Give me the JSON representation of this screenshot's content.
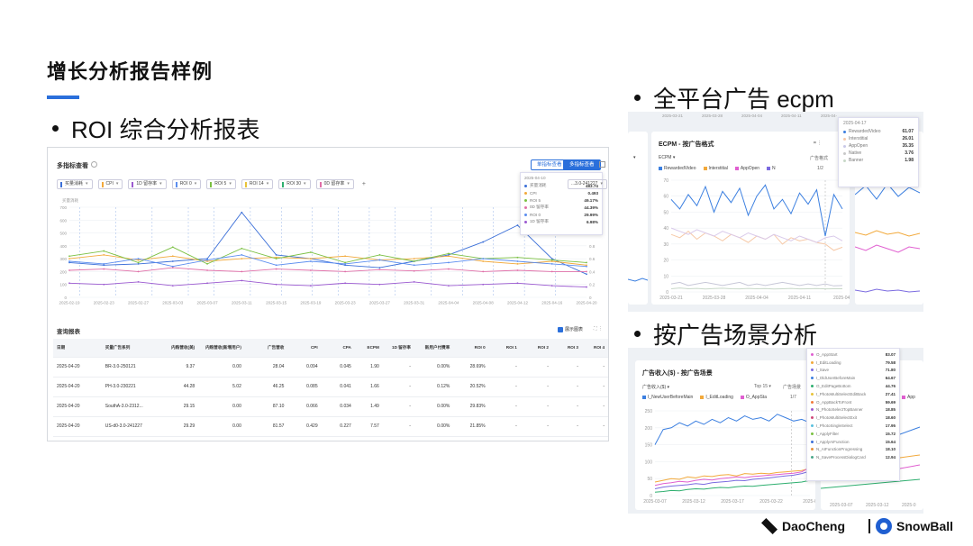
{
  "slide": {
    "title": "增长分析报告样例",
    "section_roi": "ROI 综合分析报表",
    "section_ecpm": "全平台广告 ecpm",
    "section_scene": "按广告场景分析"
  },
  "roi_panel": {
    "title": "多指标查看",
    "mode_single": "单指标查看",
    "mode_multi": "多指标查看",
    "metrics": [
      {
        "label": "买量消耗",
        "color": "#3b6fd8"
      },
      {
        "label": "CPI",
        "color": "#f2a93b"
      },
      {
        "label": "1D 留存率",
        "color": "#9b59d0"
      },
      {
        "label": "ROI 0",
        "color": "#5b8def"
      },
      {
        "label": "ROI 5",
        "color": "#7bc043"
      },
      {
        "label": "ROI 14",
        "color": "#e8c33a"
      },
      {
        "label": "ROI 30",
        "color": "#2eaf6f"
      },
      {
        "label": "0D 留存率",
        "color": "#e06fa8"
      }
    ],
    "add_label": "+",
    "left_axis_name": "买量消耗",
    "right_axis_name": "CPI",
    "tooltip": {
      "date": "2025-04-10",
      "rows": [
        {
          "name": "买量消耗",
          "value": "483.74",
          "color": "#3b6fd8"
        },
        {
          "name": "CPI",
          "value": "0.493",
          "color": "#f2a93b"
        },
        {
          "name": "ROI 5",
          "value": "49.17%",
          "color": "#7bc043"
        },
        {
          "name": "0D 留存率",
          "value": "44.39%",
          "color": "#e06fa8"
        },
        {
          "name": "ROI 0",
          "value": "29.99%",
          "color": "#5b8def"
        },
        {
          "name": "1D 留存率",
          "value": "6.98%",
          "color": "#9b59d0"
        }
      ]
    },
    "select_value": "...3.0-241227",
    "report_title": "查询报表",
    "report_toggle": "展示图表",
    "report_icons": "⛶  ⋮",
    "table": {
      "headers": [
        "日期",
        "买量广告系列",
        "内购营收(美)",
        "内购营收(新增用户)",
        "广告营收",
        "CPI",
        "CPA",
        "ECPM",
        "1D 留存率",
        "新用户付费率",
        "ROI 0",
        "ROI 1",
        "ROI 2",
        "ROI 3",
        "ROI 4"
      ],
      "rows": [
        [
          "2025-04-20",
          "BR-3.0-250121",
          "9.37",
          "0.00",
          "28.04",
          "0.094",
          "0.045",
          "1.90",
          "-",
          "0.00%",
          "28.69%",
          "-",
          "-",
          "-",
          "-"
        ],
        [
          "2025-04-20",
          "PH-3.0-230221",
          "44.28",
          "5.02",
          "46.25",
          "0.085",
          "0.041",
          "1.66",
          "-",
          "0.12%",
          "20.52%",
          "-",
          "-",
          "-",
          "-"
        ],
        [
          "2025-04-20",
          "SouthA-3.0-2312...",
          "29.15",
          "0.00",
          "87.10",
          "0.066",
          "0.034",
          "1.49",
          "-",
          "0.00%",
          "29.83%",
          "-",
          "-",
          "-",
          "-"
        ],
        [
          "2025-04-20",
          "US-d0-3.0-241227",
          "29.29",
          "0.00",
          "81.57",
          "0.429",
          "0.227",
          "7.57",
          "-",
          "0.00%",
          "21.85%",
          "-",
          "-",
          "-",
          "-"
        ],
        [
          "2025-04-19",
          "BR-3.0-250121",
          "19.96",
          "4.99",
          "48.18",
          "0.091",
          "0.036",
          "2.23",
          "1.01%",
          "0.12%",
          "44.27%",
          "44.38%",
          "-",
          "-",
          "-"
        ]
      ]
    }
  },
  "ecpm_panel": {
    "title": "ECPM - 按广告格式",
    "sub": "ECPM ▾",
    "format_ctrl": "广告格式",
    "page_ctrl": "1/2",
    "legend": [
      {
        "label": "RewardedVideo",
        "color": "#3b7fe0"
      },
      {
        "label": "Interstitial",
        "color": "#f2a93b"
      },
      {
        "label": "AppOpen",
        "color": "#e05fd0"
      },
      {
        "label": "N",
        "color": "#7b6be0"
      }
    ],
    "tooltip": {
      "date": "2025-04-17",
      "rows": [
        {
          "name": "RewardedVideo",
          "value": "61.07",
          "color": "#3b7fe0"
        },
        {
          "name": "Interstitial",
          "value": "26.01",
          "color": "#f6c9a8"
        },
        {
          "name": "AppOpen",
          "value": "35.35",
          "color": "#c9c9e8"
        },
        {
          "name": "Native",
          "value": "3.76",
          "color": "#c8c8c8"
        },
        {
          "name": "Banner",
          "value": "1.98",
          "color": "#c8d8c8"
        }
      ]
    },
    "top_ticks": [
      "2025-03-21",
      "2025-03-28",
      "2025-04-04",
      "2025-04-11",
      "2025-04-"
    ],
    "left_card_label": "▾"
  },
  "scene_panel": {
    "title": "广告收入($) - 按广告场景",
    "sub": "广告收入($) ▾",
    "top_ctrl": "Top 15 ▾",
    "scene_ctrl": "广告场景",
    "page_ctrl": "1/7",
    "legend": [
      {
        "label": "I_NewUserBeforeMain",
        "color": "#3b7fe0"
      },
      {
        "label": "I_EditLoading",
        "color": "#f2a93b"
      },
      {
        "label": "O_AppSta",
        "color": "#e05fd0"
      }
    ],
    "right_legend": "App",
    "tooltip_rows": [
      {
        "name": "O_AppStart",
        "value": "83.07",
        "color": "#e05fd0"
      },
      {
        "name": "I_EditLoading",
        "value": "79.58",
        "color": "#f2a93b"
      },
      {
        "name": "I_Save",
        "value": "71.80",
        "color": "#7b6be0"
      },
      {
        "name": "I_OldUserBeforeMain",
        "value": "64.67",
        "color": "#3b7fe0"
      },
      {
        "name": "O_EditPageBottom",
        "value": "44.76",
        "color": "#2eaf6f"
      },
      {
        "name": "I_PhotoMultiSelectEditBack",
        "value": "27.41",
        "color": "#e8c33a"
      },
      {
        "name": "O_AppBackToFront",
        "value": "59.69",
        "color": "#f27a3b"
      },
      {
        "name": "N_PhotoSelectTopBanner",
        "value": "18.85",
        "color": "#9b59d0"
      },
      {
        "name": "I_PhotoMultiSelectExit",
        "value": "18.60",
        "color": "#d04a7a"
      },
      {
        "name": "I_PhotoSingleSelect",
        "value": "17.95",
        "color": "#5bc0de"
      },
      {
        "name": "I_ApplyFilter",
        "value": "15.72",
        "color": "#7bc043"
      },
      {
        "name": "I_ApplyAIFunction",
        "value": "15.64",
        "color": "#3b6fd8"
      },
      {
        "name": "N_AIFunctionProgressing",
        "value": "18.10",
        "color": "#e8903a"
      },
      {
        "name": "N_SaveProcessDialogCard",
        "value": "12.94",
        "color": "#4aa88a"
      }
    ],
    "x_ticks": [
      "2025-03-07",
      "2025-03-12",
      "2025-03-17",
      "2025-03-22",
      "2025-0"
    ],
    "right_x_ticks": [
      "2025-03-07",
      "2025-03-12",
      "2025-0"
    ]
  },
  "chart_data": [
    {
      "type": "line",
      "title": "多指标查看",
      "xlabel": "",
      "ylabel": "买量消耗",
      "x": [
        "2025-02-19",
        "2025-02-23",
        "2025-02-27",
        "2025-03-03",
        "2025-03-07",
        "2025-03-11",
        "2025-03-15",
        "2025-03-19",
        "2025-03-23",
        "2025-03-27",
        "2025-03-31",
        "2025-04-04",
        "2025-04-08",
        "2025-04-12",
        "2025-04-16",
        "2025-04-20"
      ],
      "ylim": [
        0,
        700
      ],
      "yticks": [
        0,
        100,
        200,
        300,
        400,
        500,
        600,
        700
      ],
      "right_yticks": [
        "0",
        "0.2",
        "0.4",
        "0.6",
        "0.8",
        "1",
        "1.2",
        "1.4"
      ],
      "series": [
        {
          "name": "买量消耗",
          "color": "#3b6fd8",
          "values": [
            270,
            250,
            260,
            280,
            300,
            660,
            330,
            300,
            250,
            230,
            280,
            330,
            430,
            560,
            300,
            180
          ]
        },
        {
          "name": "CPI",
          "color": "#f2a93b",
          "values": [
            300,
            330,
            290,
            320,
            280,
            300,
            310,
            300,
            320,
            290,
            300,
            320,
            280,
            260,
            280,
            250
          ]
        },
        {
          "name": "ROI 5",
          "color": "#7bc043",
          "values": [
            320,
            360,
            270,
            390,
            260,
            380,
            300,
            350,
            270,
            330,
            280,
            340,
            300,
            310,
            290,
            270
          ]
        },
        {
          "name": "0D 留存率",
          "color": "#e06fa8",
          "values": [
            210,
            220,
            200,
            230,
            210,
            200,
            220,
            210,
            200,
            215,
            205,
            220,
            200,
            210,
            200,
            200
          ]
        },
        {
          "name": "ROI 0",
          "color": "#5b8def",
          "values": [
            280,
            260,
            300,
            240,
            290,
            330,
            250,
            280,
            260,
            290,
            250,
            270,
            300,
            280,
            260,
            240
          ]
        },
        {
          "name": "1D 留存率",
          "color": "#9b59d0",
          "values": [
            110,
            100,
            120,
            90,
            110,
            130,
            100,
            90,
            110,
            100,
            120,
            90,
            100,
            110,
            90,
            80
          ]
        }
      ]
    },
    {
      "type": "line",
      "title": "ECPM - 按广告格式",
      "xlabel": "",
      "ylabel": "ECPM",
      "x": [
        "2025-03-21",
        "2025-03-28",
        "2025-04-04",
        "2025-04-11",
        "2025-04-17"
      ],
      "ylim": [
        0,
        70
      ],
      "yticks": [
        0,
        10,
        20,
        30,
        40,
        50,
        60,
        70
      ],
      "series": [
        {
          "name": "RewardedVideo",
          "color": "#3b7fe0",
          "values": [
            58,
            52,
            61,
            54,
            66,
            50,
            63,
            56,
            65,
            48,
            60,
            67,
            52,
            58,
            49,
            62,
            55,
            64,
            35,
            61,
            52
          ]
        },
        {
          "name": "Interstitial",
          "color": "#f6c9a8",
          "values": [
            36,
            34,
            38,
            33,
            37,
            35,
            32,
            36,
            34,
            31,
            35,
            33,
            36,
            30,
            34,
            32,
            33,
            31,
            30,
            26,
            28
          ]
        },
        {
          "name": "AppOpen",
          "color": "#d9c9ea",
          "values": [
            40,
            38,
            36,
            39,
            37,
            35,
            38,
            36,
            34,
            37,
            35,
            33,
            36,
            34,
            32,
            35,
            33,
            31,
            34,
            35,
            32
          ]
        },
        {
          "name": "Native",
          "color": "#c8c8d8",
          "values": [
            5,
            6,
            4,
            5,
            6,
            5,
            4,
            5,
            6,
            4,
            5,
            4,
            5,
            6,
            5,
            4,
            5,
            4,
            5,
            3.8,
            4
          ]
        },
        {
          "name": "Banner",
          "color": "#c8d8c8",
          "values": [
            2,
            2.5,
            2,
            2.2,
            1.8,
            2.1,
            2.3,
            2,
            1.9,
            2.2,
            2,
            2.1,
            1.8,
            2,
            2.2,
            1.9,
            2,
            2.1,
            1.9,
            1.98,
            2
          ]
        }
      ]
    },
    {
      "type": "line",
      "title": "广告收入($) - 按广告场景",
      "xlabel": "",
      "ylabel": "广告收入($)",
      "x": [
        "2025-03-07",
        "2025-03-12",
        "2025-03-17",
        "2025-03-22",
        "2025-03-27"
      ],
      "ylim": [
        0,
        250
      ],
      "yticks": [
        0,
        50,
        100,
        150,
        200,
        250
      ],
      "series": [
        {
          "name": "I_NewUserBeforeMain",
          "color": "#3b7fe0",
          "values": [
            150,
            195,
            200,
            215,
            205,
            220,
            210,
            225,
            215,
            230,
            220,
            235,
            225,
            230,
            220,
            240,
            230,
            220,
            225,
            215
          ]
        },
        {
          "name": "I_EditLoading",
          "color": "#f2a93b",
          "values": [
            40,
            45,
            50,
            48,
            55,
            52,
            58,
            56,
            60,
            62,
            58,
            65,
            63,
            66,
            64,
            68,
            70,
            72,
            74,
            80
          ]
        },
        {
          "name": "O_AppStart",
          "color": "#e05fd0",
          "values": [
            30,
            35,
            38,
            42,
            40,
            45,
            48,
            46,
            50,
            52,
            55,
            53,
            56,
            58,
            60,
            62,
            64,
            66,
            70,
            83
          ]
        },
        {
          "name": "I_Save",
          "color": "#7b6be0",
          "values": [
            20,
            25,
            28,
            30,
            32,
            35,
            33,
            38,
            40,
            42,
            45,
            44,
            48,
            50,
            52,
            55,
            58,
            60,
            65,
            72
          ]
        },
        {
          "name": "O_EditPageBottom",
          "color": "#2eaf6f",
          "values": [
            10,
            12,
            15,
            14,
            18,
            20,
            19,
            22,
            24,
            23,
            26,
            28,
            27,
            30,
            32,
            34,
            36,
            38,
            40,
            45
          ]
        }
      ]
    }
  ],
  "brand": {
    "daocheng": "DaoCheng",
    "snowball": "SnowBall"
  }
}
